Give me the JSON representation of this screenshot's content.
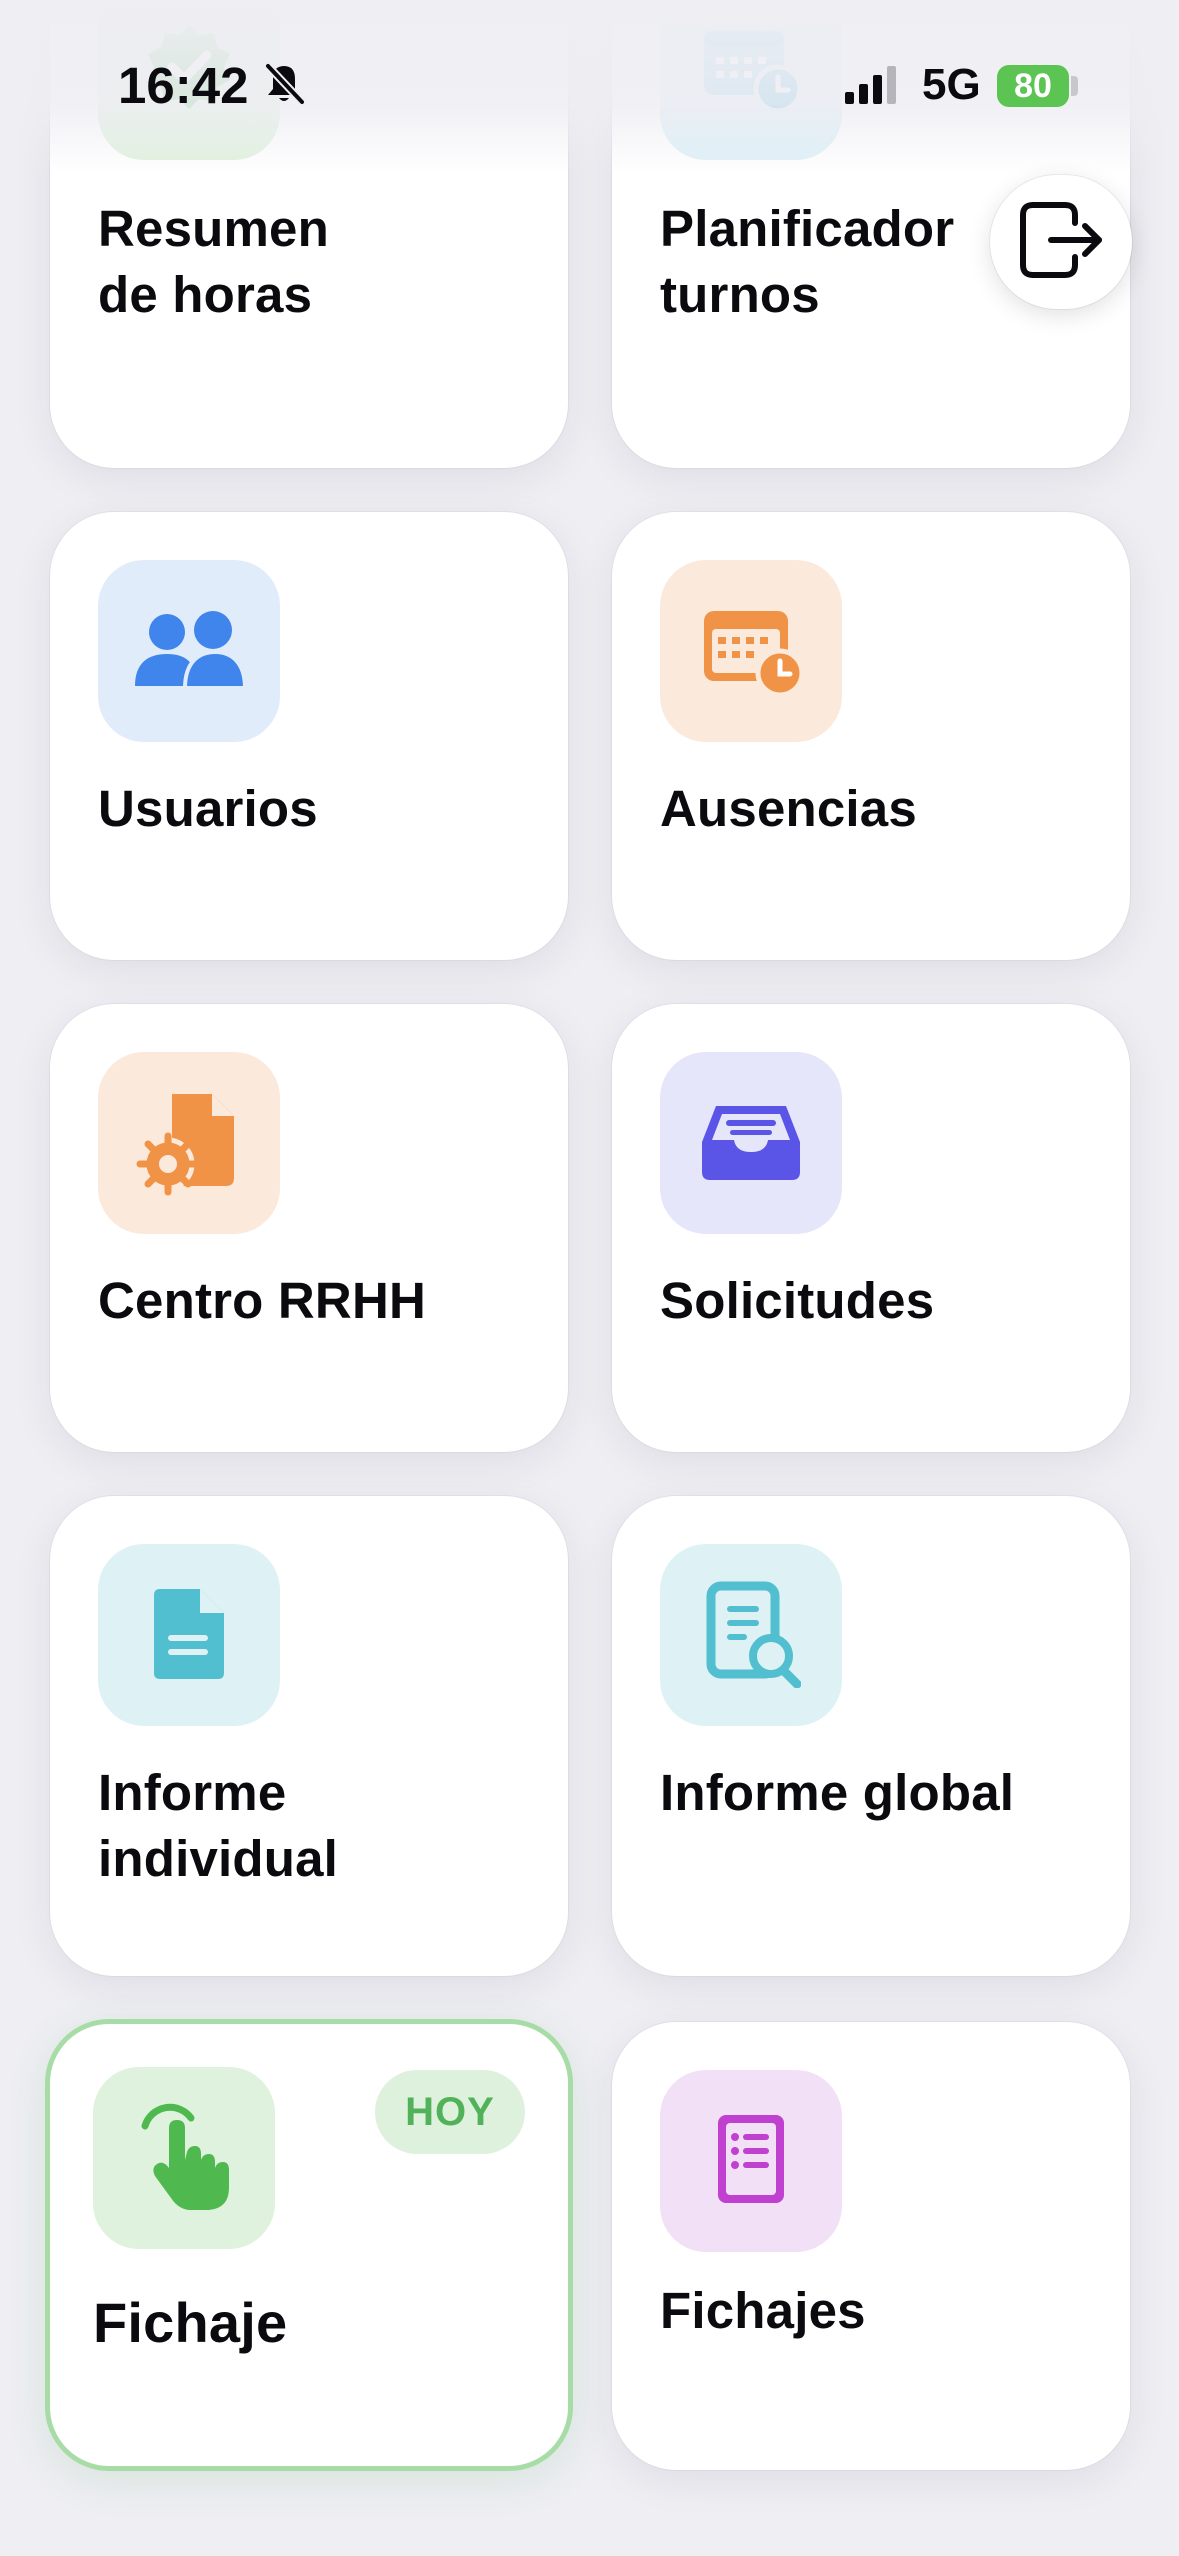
{
  "status_bar": {
    "time": "16:42",
    "network": "5G",
    "battery": "80",
    "icons": [
      "bell-slash-icon",
      "signal-icon",
      "battery-charging-icon"
    ]
  },
  "logout": {
    "icon": "logout-icon"
  },
  "cards": [
    {
      "label": "Resumen\nde horas",
      "icon": "verified-badge-icon",
      "tile_bg": "#dff1dd",
      "icon_color": "#5cbf5e"
    },
    {
      "label": "Planificador\nturnos",
      "icon": "calendar-clock-icon",
      "tile_bg": "#dcf0f7",
      "icon_color": "#4fb3df"
    },
    {
      "label": "Usuarios",
      "icon": "users-icon",
      "tile_bg": "#e1ecfb",
      "icon_color": "#3f85ec"
    },
    {
      "label": "Ausencias",
      "icon": "calendar-clock-icon",
      "tile_bg": "#fbe9dc",
      "icon_color": "#f09346"
    },
    {
      "label": "Centro RRHH",
      "icon": "document-gear-icon",
      "tile_bg": "#fbe9dc",
      "icon_color": "#f09346"
    },
    {
      "label": "Solicitudes",
      "icon": "inbox-tray-icon",
      "tile_bg": "#e6e6fb",
      "icon_color": "#5a55e6"
    },
    {
      "label": "Informe\nindividual",
      "icon": "document-icon",
      "tile_bg": "#def2f5",
      "icon_color": "#51bfcf"
    },
    {
      "label": "Informe global",
      "icon": "document-search-icon",
      "tile_bg": "#def2f5",
      "icon_color": "#51bfcf"
    },
    {
      "label": "Fichaje",
      "icon": "tap-hand-icon",
      "tile_bg": "#def2dd",
      "icon_color": "#4fb84f",
      "badge": "HOY",
      "active": true
    },
    {
      "label": "Fichajes",
      "icon": "list-document-icon",
      "tile_bg": "#f2e1f6",
      "icon_color": "#c040d0"
    }
  ]
}
